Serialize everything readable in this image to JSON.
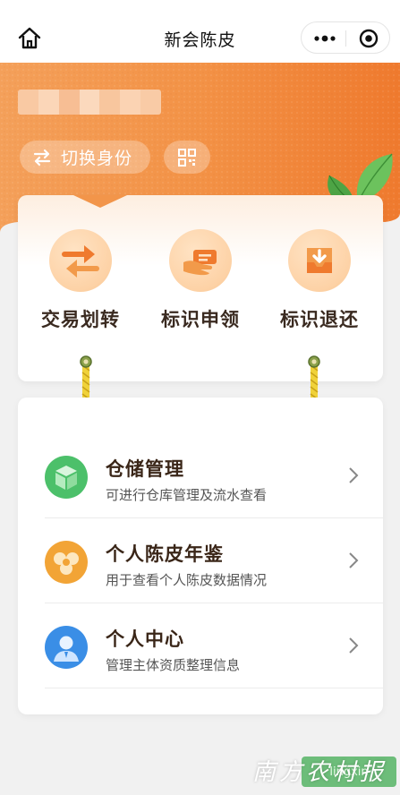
{
  "navbar": {
    "title": "新会陈皮"
  },
  "header": {
    "switch_label": "切换身份"
  },
  "actions": [
    {
      "label": "交易划转",
      "icon": "transfer-icon"
    },
    {
      "label": "标识申领",
      "icon": "hand-card-icon"
    },
    {
      "label": "标识退还",
      "icon": "inbox-return-icon"
    }
  ],
  "menu": [
    {
      "title": "仓储管理",
      "subtitle": "可进行仓库管理及流水查看",
      "icon": "box-icon",
      "color": "#4cc06a"
    },
    {
      "title": "个人陈皮年鉴",
      "subtitle": "用于查看个人陈皮数据情况",
      "icon": "flower-icon",
      "color": "#f2a436"
    },
    {
      "title": "个人中心",
      "subtitle": "管理主体资质整理信息",
      "icon": "person-icon",
      "color": "#3a8ee6"
    }
  ],
  "colors": {
    "brand_orange": "#f08a3c",
    "card_accent": "#fdd2a6",
    "rope": "#f0d23a"
  },
  "watermark": {
    "text": "南方农村报",
    "badge": "lingxin"
  }
}
